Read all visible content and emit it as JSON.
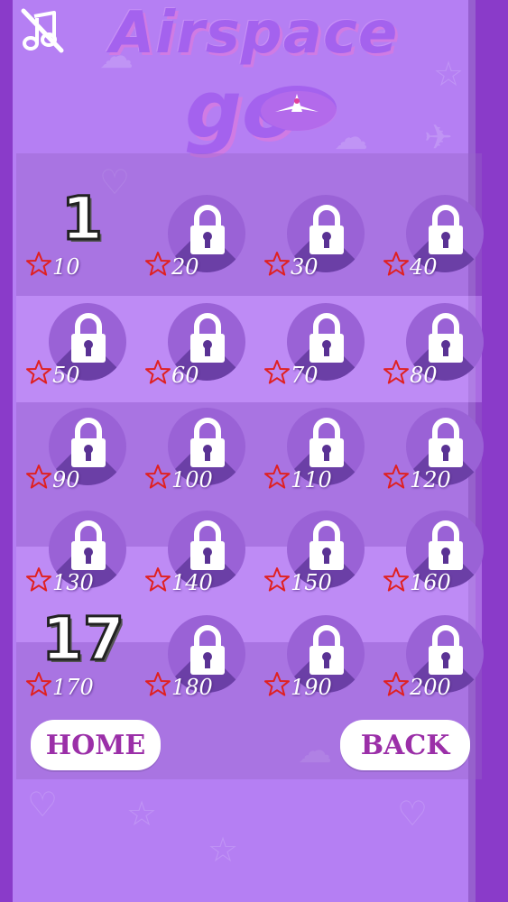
{
  "title": {
    "line1": "Airspace",
    "line2": "go"
  },
  "buttons": {
    "home": "HOME",
    "back": "BACK"
  },
  "icons": {
    "music": "music-muted-icon",
    "lock": "padlock-icon",
    "star": "star-outline-icon",
    "plane": "plane-icon"
  },
  "colors": {
    "background": "#b57ff3",
    "frame": "#8a3bc9",
    "title": "#a462ee",
    "button_text": "#9b2fa8",
    "star": "#e02020"
  },
  "levels": [
    {
      "number": "1",
      "required_stars": "10",
      "locked": false
    },
    {
      "number": "",
      "required_stars": "20",
      "locked": true
    },
    {
      "number": "",
      "required_stars": "30",
      "locked": true
    },
    {
      "number": "",
      "required_stars": "40",
      "locked": true
    },
    {
      "number": "",
      "required_stars": "50",
      "locked": true
    },
    {
      "number": "",
      "required_stars": "60",
      "locked": true
    },
    {
      "number": "",
      "required_stars": "70",
      "locked": true
    },
    {
      "number": "",
      "required_stars": "80",
      "locked": true
    },
    {
      "number": "",
      "required_stars": "90",
      "locked": true
    },
    {
      "number": "",
      "required_stars": "100",
      "locked": true
    },
    {
      "number": "",
      "required_stars": "110",
      "locked": true
    },
    {
      "number": "",
      "required_stars": "120",
      "locked": true
    },
    {
      "number": "",
      "required_stars": "130",
      "locked": true
    },
    {
      "number": "",
      "required_stars": "140",
      "locked": true
    },
    {
      "number": "",
      "required_stars": "150",
      "locked": true
    },
    {
      "number": "",
      "required_stars": "160",
      "locked": true
    },
    {
      "number": "17",
      "required_stars": "170",
      "locked": false
    },
    {
      "number": "",
      "required_stars": "180",
      "locked": true
    },
    {
      "number": "",
      "required_stars": "190",
      "locked": true
    },
    {
      "number": "",
      "required_stars": "200",
      "locked": true
    }
  ]
}
